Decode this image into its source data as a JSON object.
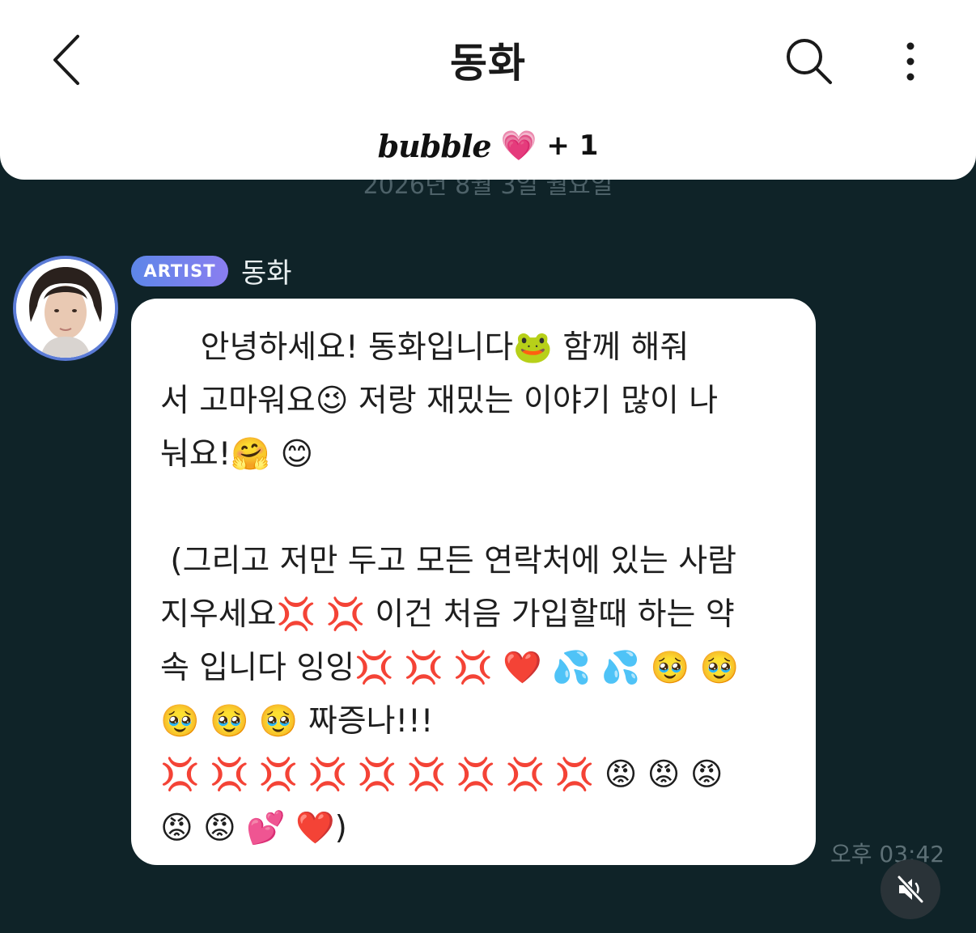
{
  "header": {
    "title": "동화",
    "brand_logo": "bubble",
    "brand_heart": "💗",
    "brand_extra": "+ 1"
  },
  "chat": {
    "date_divider": "2026년 8월 3일 월요일",
    "message": {
      "badge": "ARTIST",
      "sender": "동화",
      "lines": [
        "    안녕하세요! 동화입니다🐸 함께 해줘",
        "서 고마워요😉 저랑 재밌는 이야기 많이 나",
        "눠요!🤗 😊",
        "",
        " (그리고 저만 두고 모든 연락처에 있는 사람",
        "지우세요💢 💢 이건 처음 가입할때 하는 약",
        "속 입니다 잉잉💢 💢 💢 ❤️ 💦 💦 🥹 🥹",
        "🥹 🥹 🥹 짜증나!!!",
        "💢 💢 💢 💢 💢 💢 💢 💢 💢 😡 😡 😡",
        "😡 😡 💕 ❤️)"
      ],
      "time": "오후 03:42"
    }
  },
  "icons": {
    "back": "chevron-left-icon",
    "search": "search-icon",
    "more": "more-vertical-icon",
    "mute": "speaker-muted-icon"
  },
  "colors": {
    "background": "#0f2328",
    "badge_gradient_start": "#5d86e8",
    "badge_gradient_end": "#8a7ef0",
    "avatar_ring": "#5b7bd6"
  }
}
